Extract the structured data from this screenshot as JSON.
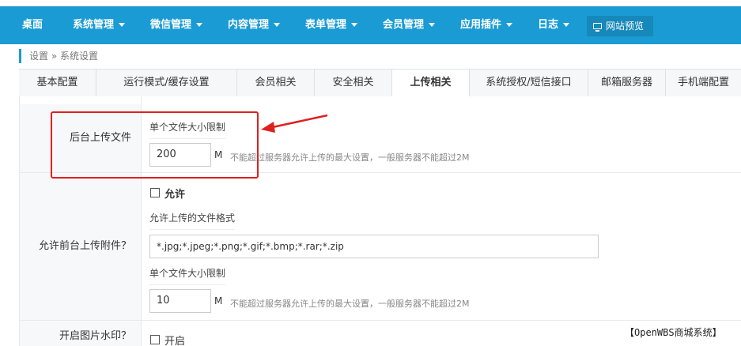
{
  "nav": {
    "items": [
      {
        "label": "桌面",
        "has_caret": false
      },
      {
        "label": "系统管理",
        "has_caret": true
      },
      {
        "label": "微信管理",
        "has_caret": true
      },
      {
        "label": "内容管理",
        "has_caret": true
      },
      {
        "label": "表单管理",
        "has_caret": true
      },
      {
        "label": "会员管理",
        "has_caret": true
      },
      {
        "label": "应用插件",
        "has_caret": true
      },
      {
        "label": "日志",
        "has_caret": true
      }
    ],
    "preview_label": "网站预览"
  },
  "breadcrumb": "设置 » 系统设置",
  "tabs": [
    {
      "label": "基本配置"
    },
    {
      "label": "运行模式/缓存设置"
    },
    {
      "label": "会员相关"
    },
    {
      "label": "安全相关"
    },
    {
      "label": "上传相关",
      "active": true
    },
    {
      "label": "系统授权/短信接口"
    },
    {
      "label": "邮箱服务器"
    },
    {
      "label": "手机端配置"
    }
  ],
  "form": {
    "backend_upload": {
      "label": "后台上传文件",
      "size_title": "单个文件大小限制",
      "size_value": "200",
      "unit": "M",
      "hint": "不能超过服务器允许上传的最大设置，一般服务器不能超过2M"
    },
    "frontend_upload": {
      "label": "允许前台上传附件？",
      "allow_label": "允许",
      "allow_checked": false,
      "format_title": "允许上传的文件格式",
      "format_value": "*.jpg;*.jpeg;*.png;*.gif;*.bmp;*.rar;*.zip",
      "size_title": "单个文件大小限制",
      "size_value": "10",
      "unit": "M",
      "hint": "不能超过服务器允许上传的最大设置，一般服务器不能超过2M"
    },
    "watermark": {
      "label": "开启图片水印？",
      "enable_label": "开启",
      "enable_checked": false
    }
  },
  "watermark_text": "【OpenWBS商城系统】",
  "colors": {
    "navbar": "#1a9bd4",
    "highlight": "#e02020"
  }
}
